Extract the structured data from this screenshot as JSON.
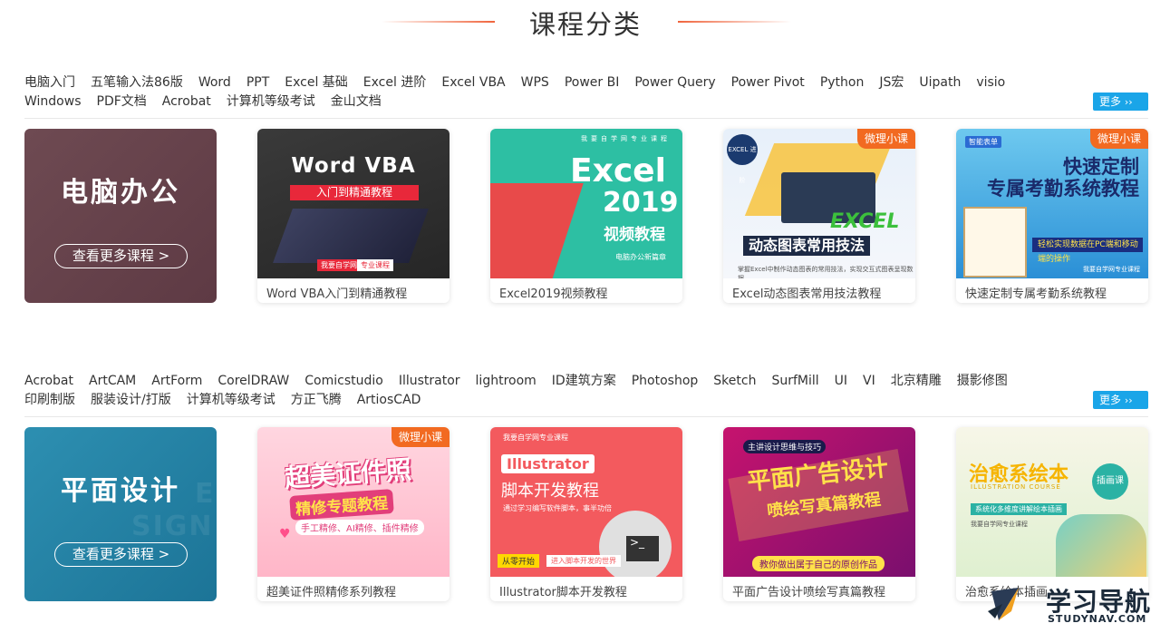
{
  "page": {
    "title": "课程分类"
  },
  "sections": [
    {
      "tags_row1": [
        "电脑入门",
        "五笔输入法86版",
        "Word",
        "PPT",
        "Excel 基础",
        "Excel 进阶",
        "Excel VBA",
        "WPS",
        "Power BI",
        "Power Query",
        "Power Pivot",
        "Python",
        "JS宏",
        "Uipath",
        "visio"
      ],
      "tags_row2": [
        "Windows",
        "PDF文档",
        "Acrobat",
        "计算机等级考试",
        "金山文档"
      ],
      "more_label": "更多",
      "feature": {
        "title": "电脑办公",
        "button_label": "查看更多课程 >"
      },
      "courses": [
        {
          "caption": "Word VBA入门到精通教程",
          "badge": "",
          "art": {
            "big": "Word VBA",
            "bar": "入门到精通教程",
            "tag1": "我要自学网",
            "tag2": "专业课程"
          }
        },
        {
          "caption": "Excel2019视频教程",
          "badge": "",
          "art": {
            "top": "我要自学网专业课程",
            "big": "Excel",
            "year": "2019",
            "sub": "视频教程",
            "foot": "电脑办公新篇章"
          }
        },
        {
          "caption": "Excel动态图表常用技法教程",
          "badge": "微理小课",
          "art": {
            "logo": "EXCEL 进阶",
            "green": "EXCEL",
            "dark": "动态图表常用技法",
            "foot": "掌握Excel中制作动态图表的常用技法，实现交互式图表呈现数据"
          }
        },
        {
          "caption": "快速定制专属考勤系统教程",
          "badge": "微理小课",
          "art": {
            "tl": "智能表单",
            "big1": "快速定制",
            "big2": "专属考勤系统教程",
            "stripe": "轻松实现数据在PC端和移动端的操作",
            "foot": "我要自学网专业课程"
          }
        }
      ]
    },
    {
      "tags_row1": [
        "Acrobat",
        "ArtCAM",
        "ArtForm",
        "CorelDRAW",
        "Comicstudio",
        "Illustrator",
        "lightroom",
        "ID建筑方案",
        "Photoshop",
        "Sketch",
        "SurfMill",
        "UI",
        "VI",
        "北京精雕",
        "摄影修图"
      ],
      "tags_row2": [
        "印刷制版",
        "服装设计/打版",
        "计算机等级考试",
        "方正飞腾",
        "ArtiosCAD"
      ],
      "more_label": "更多",
      "feature": {
        "title": "平面设计",
        "button_label": "查看更多课程 >",
        "ghost1": "E",
        "ghost2": "SIGN"
      },
      "courses": [
        {
          "caption": "超美证件照精修系列教程",
          "badge": "微理小课",
          "art": {
            "big": "超美证件照",
            "mid": "精修专题教程",
            "small": "手工精修、AI精修、插件精修"
          }
        },
        {
          "caption": "Illustrator脚本开发教程",
          "badge": "",
          "art": {
            "top": "我要自学网专业课程",
            "ai": "Illustrator",
            "sub": "脚本开发教程",
            "note": "通过学习编写软件脚本，事半功倍",
            "term": ">_",
            "start": "从零开始",
            "enter": "进入脚本开发的世界"
          }
        },
        {
          "caption": "平面广告设计喷绘写真篇教程",
          "badge": "",
          "art": {
            "top": "主讲设计思维与技巧",
            "big": "平面广告设计",
            "sub": "喷绘写真篇教程",
            "foot": "教你做出属于自己的原创作品"
          }
        },
        {
          "caption": "治愈系绘本插画",
          "badge": "",
          "art": {
            "big": "治愈系绘本",
            "circ": "插画课",
            "eng": "ILLUSTRATION COURSE",
            "strip": "系统化多维度讲解绘本插画",
            "foot": "我要自学网专业课程"
          }
        }
      ]
    }
  ],
  "watermark": {
    "cn": "学习导航",
    "en": "STUDYNAV.COM"
  },
  "colors": {
    "accent": "#f0643c",
    "more_button": "#1aa5e8",
    "badge": "#f26a21"
  }
}
